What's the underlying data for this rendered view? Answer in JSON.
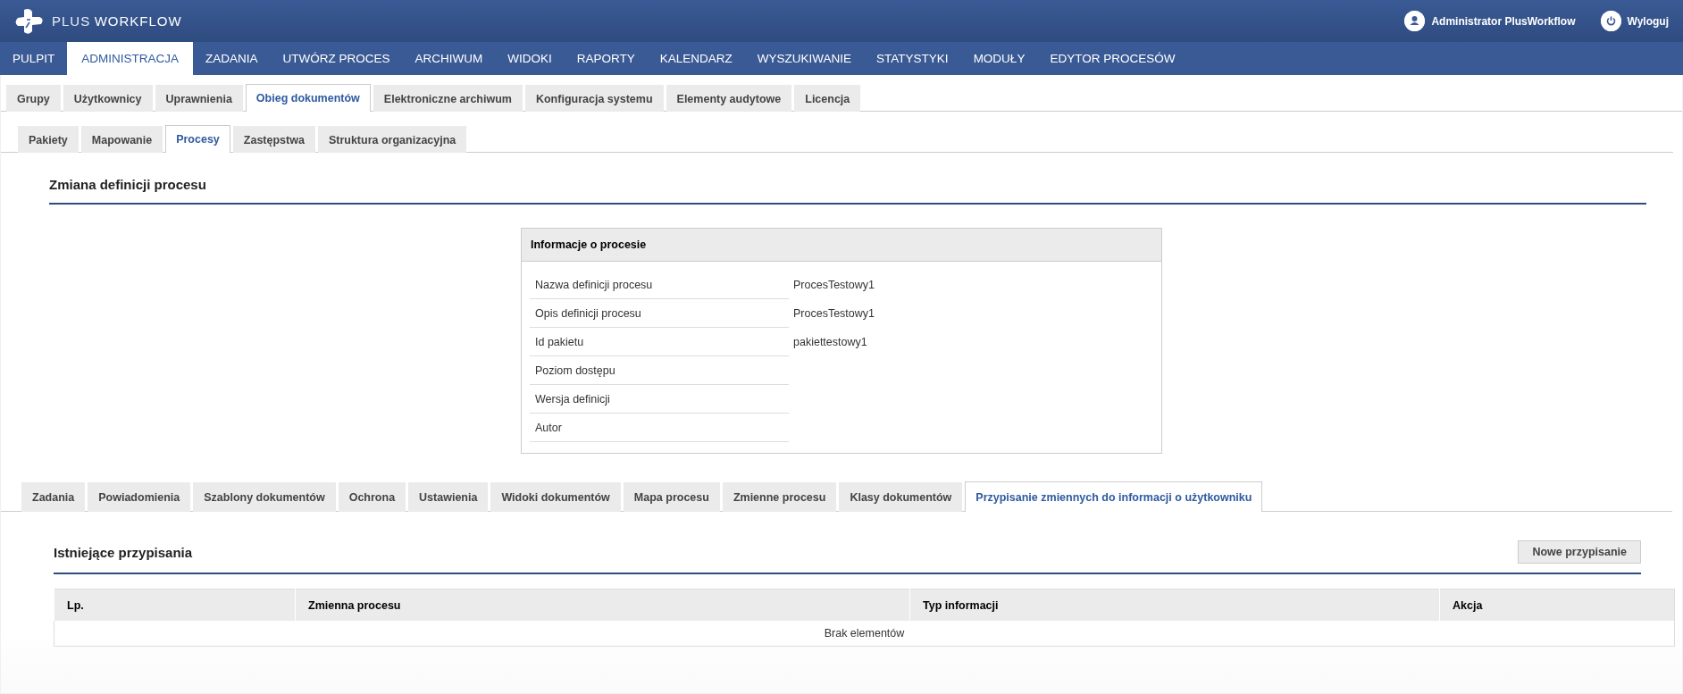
{
  "header": {
    "logo": {
      "part_1": "PLUS",
      "part_2": "WORKFLOW"
    },
    "user": "Administrator PlusWorkflow",
    "logout": "Wyloguj"
  },
  "main_menu": [
    {
      "label": "PULPIT",
      "selected": false
    },
    {
      "label": "ADMINISTRACJA",
      "selected": true
    },
    {
      "label": "ZADANIA",
      "selected": false
    },
    {
      "label": "UTWÓRZ PROCES",
      "selected": false
    },
    {
      "label": "ARCHIWUM",
      "selected": false
    },
    {
      "label": "WIDOKI",
      "selected": false
    },
    {
      "label": "RAPORTY",
      "selected": false
    },
    {
      "label": "KALENDARZ",
      "selected": false
    },
    {
      "label": "WYSZUKIWANIE",
      "selected": false
    },
    {
      "label": "STATYSTYKI",
      "selected": false
    },
    {
      "label": "MODUŁY",
      "selected": false
    },
    {
      "label": "EDYTOR PROCESÓW",
      "selected": false
    }
  ],
  "admin_tabs": [
    {
      "label": "Grupy",
      "selected": false
    },
    {
      "label": "Użytkownicy",
      "selected": false
    },
    {
      "label": "Uprawnienia",
      "selected": false
    },
    {
      "label": "Obieg dokumentów",
      "selected": true
    },
    {
      "label": "Elektroniczne archiwum",
      "selected": false
    },
    {
      "label": "Konfiguracja systemu",
      "selected": false
    },
    {
      "label": "Elementy audytowe",
      "selected": false
    },
    {
      "label": "Licencja",
      "selected": false
    }
  ],
  "sub_tabs": [
    {
      "label": "Pakiety",
      "selected": false
    },
    {
      "label": "Mapowanie",
      "selected": false
    },
    {
      "label": "Procesy",
      "selected": true
    },
    {
      "label": "Zastępstwa",
      "selected": false
    },
    {
      "label": "Struktura organizacyjna",
      "selected": false
    }
  ],
  "page_title": "Zmiana definicji procesu",
  "info_panel": {
    "title": "Informacje o procesie",
    "fields": [
      {
        "label": "Nazwa definicji procesu",
        "value": "ProcesTestowy1"
      },
      {
        "label": "Opis definicji procesu",
        "value": "ProcesTestowy1"
      },
      {
        "label": "Id pakietu",
        "value": "pakiettestowy1"
      },
      {
        "label": "Poziom dostępu"
      },
      {
        "label": "Wersja definicji"
      },
      {
        "label": "Autor"
      }
    ]
  },
  "process_tabs": [
    {
      "label": "Zadania",
      "selected": false
    },
    {
      "label": "Powiadomienia",
      "selected": false
    },
    {
      "label": "Szablony dokumentów",
      "selected": false
    },
    {
      "label": "Ochrona",
      "selected": false
    },
    {
      "label": "Ustawienia",
      "selected": false
    },
    {
      "label": "Widoki dokumentów",
      "selected": false
    },
    {
      "label": "Mapa procesu",
      "selected": false
    },
    {
      "label": "Zmienne procesu",
      "selected": false
    },
    {
      "label": "Klasy dokumentów",
      "selected": false
    },
    {
      "label": "Przypisanie zmiennych do informacji o użytkowniku",
      "selected": true
    }
  ],
  "section": {
    "title": "Istniejące przypisania",
    "new_button": "Nowe przypisanie",
    "table": {
      "columns": [
        "Lp.",
        "Zmienna procesu",
        "Typ informacji",
        "Akcja"
      ],
      "empty_message": "Brak elementów"
    }
  }
}
